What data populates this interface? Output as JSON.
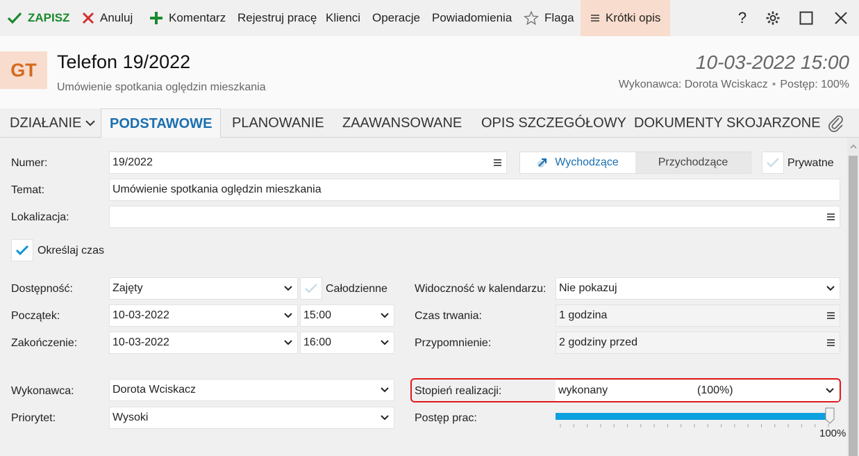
{
  "toolbar": {
    "save": "ZAPISZ",
    "cancel": "Anuluj",
    "comment": "Komentarz",
    "register_work": "Rejestruj pracę",
    "clients": "Klienci",
    "operations": "Operacje",
    "notifications": "Powiadomienia",
    "flag": "Flaga",
    "short_description": "Krótki opis",
    "help": "?"
  },
  "header": {
    "avatar": "GT",
    "title": "Telefon 19/2022",
    "subtitle": "Umówienie spotkania oględzin mieszkania",
    "date": "10-03-2022 15:00",
    "performer_meta": "Wykonawca: Dorota Wciskacz",
    "progress_meta": "Postęp: 100%"
  },
  "tabs": {
    "action": "DZIAŁANIE",
    "basic": "PODSTAWOWE",
    "planning": "PLANOWANIE",
    "advanced": "ZAAWANSOWANE",
    "detailed": "OPIS SZCZEGÓŁOWY",
    "linked_docs": "DOKUMENTY SKOJARZONE"
  },
  "form": {
    "number_label": "Numer:",
    "number_value": "19/2022",
    "direction_outgoing": "Wychodzące",
    "direction_incoming": "Przychodzące",
    "private_label": "Prywatne",
    "subject_label": "Temat:",
    "subject_value": "Umówienie spotkania oględzin mieszkania",
    "location_label": "Lokalizacja:",
    "location_value": "",
    "specify_time_label": "Określaj czas",
    "availability_label": "Dostępność:",
    "availability_value": "Zajęty",
    "all_day_label": "Całodzienne",
    "visibility_label": "Widoczność w kalendarzu:",
    "visibility_value": "Nie pokazuj",
    "start_label": "Początek:",
    "start_date": "10-03-2022",
    "start_time": "15:00",
    "duration_label": "Czas trwania:",
    "duration_value": "1 godzina",
    "end_label": "Zakończenie:",
    "end_date": "10-03-2022",
    "end_time": "16:00",
    "reminder_label": "Przypomnienie:",
    "reminder_value": "2 godziny przed",
    "performer_label": "Wykonawca:",
    "performer_value": "Dorota Wciskacz",
    "completion_label": "Stopień realizacji:",
    "completion_value": "wykonany",
    "completion_percent": "(100%)",
    "priority_label": "Priorytet:",
    "priority_value": "Wysoki",
    "progress_label": "Postęp prac:",
    "progress_value": "100%",
    "progress_fraction": 1.0
  },
  "colors": {
    "accent": "#1a6fb0",
    "save_green": "#1a8a2e",
    "cancel_red": "#d32f2f",
    "avatar_bg": "#f8dccd",
    "avatar_fg": "#d2691e",
    "slider": "#0da0de",
    "highlight": "#e01919"
  }
}
